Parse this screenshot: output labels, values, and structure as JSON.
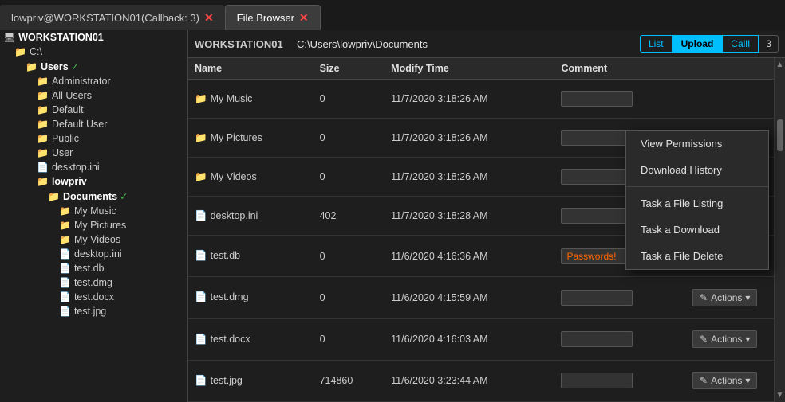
{
  "tabs": [
    {
      "id": "callback",
      "label": "lowpriv@WORKSTATION01(Callback: 3)",
      "active": false
    },
    {
      "id": "filebrowser",
      "label": "File Browser",
      "active": true
    }
  ],
  "sidebar": {
    "root_label": "WORKSTATION01",
    "tree": [
      {
        "id": "workstation",
        "label": "WORKSTATION01",
        "type": "computer",
        "indent": 0,
        "bold": true
      },
      {
        "id": "c-drive",
        "label": "C:\\",
        "type": "folder",
        "indent": 1
      },
      {
        "id": "users",
        "label": "Users",
        "type": "folder",
        "indent": 2,
        "check": true,
        "bold": true
      },
      {
        "id": "administrator",
        "label": "Administrator",
        "type": "folder",
        "indent": 3
      },
      {
        "id": "all-users",
        "label": "All Users",
        "type": "folder",
        "indent": 3
      },
      {
        "id": "default",
        "label": "Default",
        "type": "folder",
        "indent": 3
      },
      {
        "id": "default-user",
        "label": "Default User",
        "type": "folder",
        "indent": 3
      },
      {
        "id": "public",
        "label": "Public",
        "type": "folder",
        "indent": 3
      },
      {
        "id": "user",
        "label": "User",
        "type": "folder",
        "indent": 3
      },
      {
        "id": "desktop-ini-top",
        "label": "desktop.ini",
        "type": "file",
        "indent": 3
      },
      {
        "id": "lowpriv",
        "label": "lowpriv",
        "type": "folder",
        "indent": 3,
        "bold": true
      },
      {
        "id": "documents",
        "label": "Documents",
        "type": "folder",
        "indent": 4,
        "check": true,
        "bold": true
      },
      {
        "id": "my-music",
        "label": "My Music",
        "type": "folder",
        "indent": 5
      },
      {
        "id": "my-pictures",
        "label": "My Pictures",
        "type": "folder",
        "indent": 5
      },
      {
        "id": "my-videos",
        "label": "My Videos",
        "type": "folder",
        "indent": 5
      },
      {
        "id": "desktop-ini-docs",
        "label": "desktop.ini",
        "type": "file",
        "indent": 5
      },
      {
        "id": "test-db",
        "label": "test.db",
        "type": "file",
        "indent": 5
      },
      {
        "id": "test-dmg",
        "label": "test.dmg",
        "type": "file",
        "indent": 5
      },
      {
        "id": "test-docx",
        "label": "test.docx",
        "type": "file",
        "indent": 5
      },
      {
        "id": "test-jpg",
        "label": "test.jpg",
        "type": "file",
        "indent": 5
      }
    ]
  },
  "header": {
    "machine": "WORKSTATION01",
    "path": "C:\\Users\\lowpriv\\Documents",
    "buttons": [
      "List",
      "Upload",
      "CallI"
    ],
    "active_button": "Upload",
    "count": "3"
  },
  "table": {
    "columns": [
      "Name",
      "Size",
      "Modify Time",
      "Comment"
    ],
    "rows": [
      {
        "id": "row-1",
        "name": "My Music",
        "type": "folder",
        "size": "0",
        "modify_time": "11/7/2020 3:18:26 AM",
        "comment": "",
        "has_actions": false
      },
      {
        "id": "row-2",
        "name": "My Pictures",
        "type": "folder",
        "size": "0",
        "modify_time": "11/7/2020 3:18:26 AM",
        "comment": "",
        "has_actions": false
      },
      {
        "id": "row-3",
        "name": "My Videos",
        "type": "folder",
        "size": "0",
        "modify_time": "11/7/2020 3:18:26 AM",
        "comment": "",
        "has_actions": false
      },
      {
        "id": "row-4",
        "name": "desktop.ini",
        "type": "file",
        "size": "402",
        "modify_time": "11/7/2020 3:18:28 AM",
        "comment": "",
        "has_actions": false
      },
      {
        "id": "row-5",
        "name": "test.db",
        "type": "file",
        "size": "0",
        "modify_time": "11/6/2020 4:16:36 AM",
        "comment": "Passwords!",
        "has_actions": true
      },
      {
        "id": "row-6",
        "name": "test.dmg",
        "type": "file",
        "size": "0",
        "modify_time": "11/6/2020 4:15:59 AM",
        "comment": "",
        "has_actions": true
      },
      {
        "id": "row-7",
        "name": "test.docx",
        "type": "file",
        "size": "0",
        "modify_time": "11/6/2020 4:16:03 AM",
        "comment": "",
        "has_actions": true
      },
      {
        "id": "row-8",
        "name": "test.jpg",
        "type": "file",
        "size": "714860",
        "modify_time": "11/6/2020 3:23:44 AM",
        "comment": "",
        "has_actions": true
      }
    ]
  },
  "context_menu": {
    "visible": true,
    "items": [
      {
        "id": "view-permissions",
        "label": "View Permissions"
      },
      {
        "id": "download-history",
        "label": "Download History"
      },
      {
        "id": "divider",
        "label": ""
      },
      {
        "id": "task-file-listing",
        "label": "Task a File Listing"
      },
      {
        "id": "task-download",
        "label": "Task a Download"
      },
      {
        "id": "task-file-delete",
        "label": "Task a File Delete"
      }
    ]
  },
  "icons": {
    "folder": "📁",
    "file": "📄",
    "computer": "🖥",
    "edit": "✎",
    "chevron": "▾"
  }
}
